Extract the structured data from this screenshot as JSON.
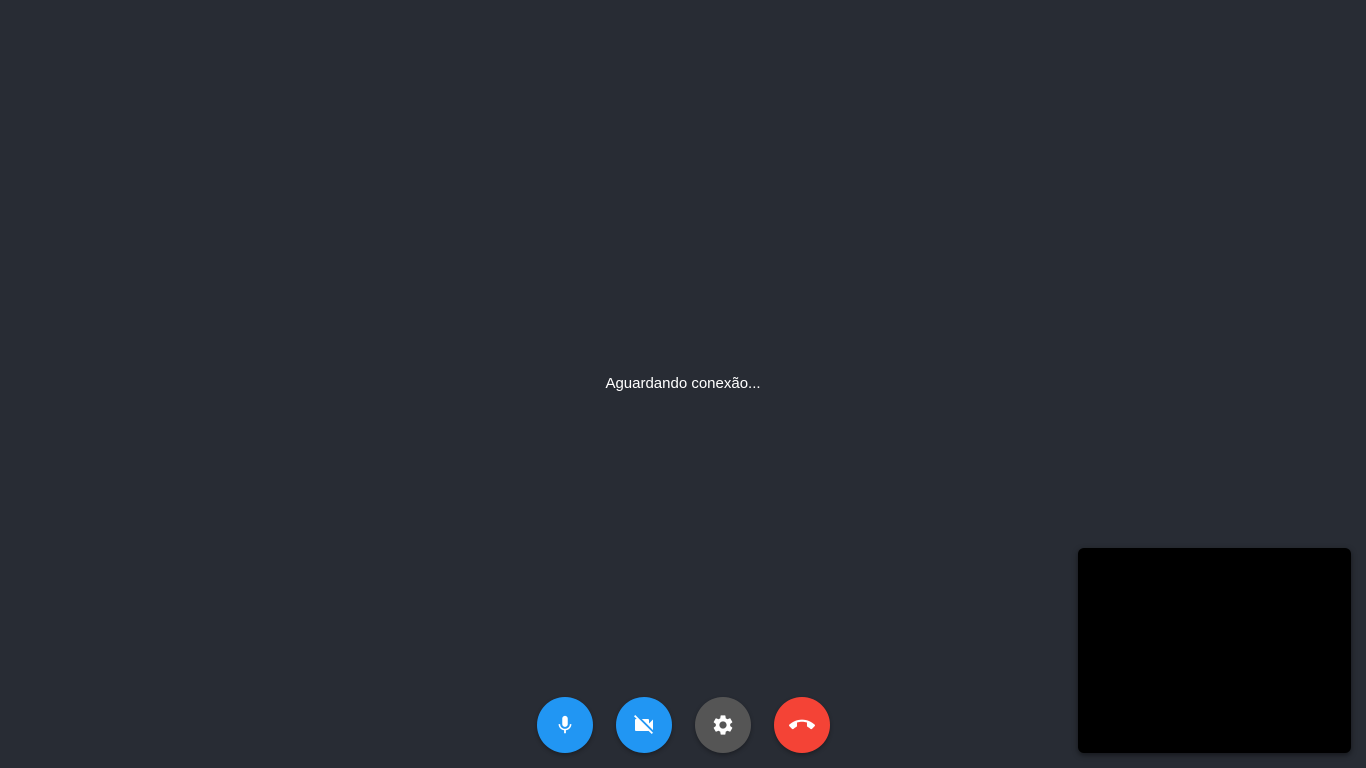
{
  "main": {
    "status_text": "Aguardando conexão..."
  },
  "self_view": {
    "state": "empty-black"
  },
  "controls": {
    "buttons": [
      {
        "name": "microphone",
        "icon": "microphone-icon",
        "color": "#2196f3"
      },
      {
        "name": "camera-off",
        "icon": "video-off-icon",
        "color": "#2196f3"
      },
      {
        "name": "settings",
        "icon": "gear-icon",
        "color": "#555555"
      },
      {
        "name": "hang-up",
        "icon": "phone-hangup-icon",
        "color": "#f44336"
      }
    ]
  },
  "colors": {
    "background": "#282c34",
    "text": "#ffffff",
    "self_view": "#000000"
  }
}
